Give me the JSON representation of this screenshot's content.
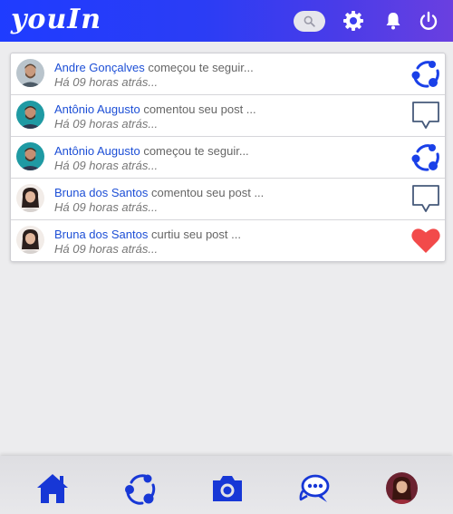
{
  "app": {
    "logo": "youIn",
    "accent": "#1a40e8"
  },
  "header": {
    "search_icon": "search-icon",
    "settings_icon": "gear-icon",
    "notifications_icon": "bell-icon",
    "logout_icon": "power-icon"
  },
  "notifications": [
    {
      "user": "Andre Gonçalves",
      "action": "começou te seguir...",
      "time": "Há 09 horas atrás...",
      "icon": "connections-icon"
    },
    {
      "user": "Antônio Augusto",
      "action": "comentou seu post ...",
      "time": "Há 09 horas atrás...",
      "icon": "comment-icon"
    },
    {
      "user": "Antônio Augusto",
      "action": "começou te seguir...",
      "time": "Há 09 horas atrás...",
      "icon": "connections-icon"
    },
    {
      "user": "Bruna dos Santos",
      "action": "comentou seu post ...",
      "time": "Há 09 horas atrás...",
      "icon": "comment-icon"
    },
    {
      "user": "Bruna dos Santos",
      "action": "curtiu seu post ...",
      "time": "Há 09 horas atrás...",
      "icon": "heart-icon"
    }
  ],
  "bottom_nav": {
    "items": [
      "home-icon",
      "connections-icon",
      "camera-icon",
      "chat-icon",
      "profile-avatar"
    ]
  },
  "colors": {
    "link": "#1d4fd6",
    "heart": "#f24a4a",
    "nav": "#1737d6"
  }
}
